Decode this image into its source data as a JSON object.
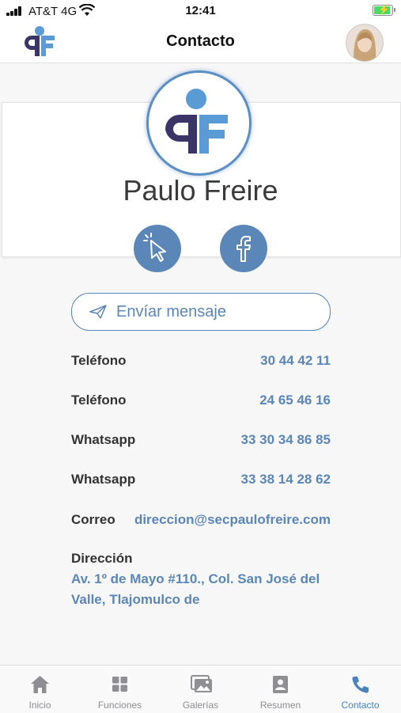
{
  "status_bar": {
    "carrier": "AT&T 4G",
    "time": "12:41"
  },
  "header": {
    "title": "Contacto"
  },
  "profile": {
    "name": "Paulo Freire"
  },
  "actions": {
    "send_message": "Envíar mensaje"
  },
  "contacts": [
    {
      "label": "Teléfono",
      "value": "30 44 42 11"
    },
    {
      "label": "Teléfono",
      "value": "24 65 46 16"
    },
    {
      "label": "Whatsapp",
      "value": "33 30 34 86 85"
    },
    {
      "label": "Whatsapp",
      "value": "33 38 14 28 62"
    },
    {
      "label": "Correo",
      "value": "direccion@secpaulofreire.com"
    }
  ],
  "address": {
    "label": "Dirección",
    "value": "Av. 1º de Mayo #110., Col. San José del Valle, Tlajomulco de"
  },
  "tabs": [
    {
      "label": "Inicio",
      "icon": "home-icon"
    },
    {
      "label": "Funciones",
      "icon": "grid-icon"
    },
    {
      "label": "Galerías",
      "icon": "gallery-icon"
    },
    {
      "label": "Resumen",
      "icon": "profile-card-icon"
    },
    {
      "label": "Contacto",
      "icon": "phone-icon"
    }
  ],
  "colors": {
    "accent": "#5b86b8",
    "logo_dark": "#3b3466",
    "logo_light": "#5b9bd5",
    "tab_active": "#4a82bd"
  }
}
